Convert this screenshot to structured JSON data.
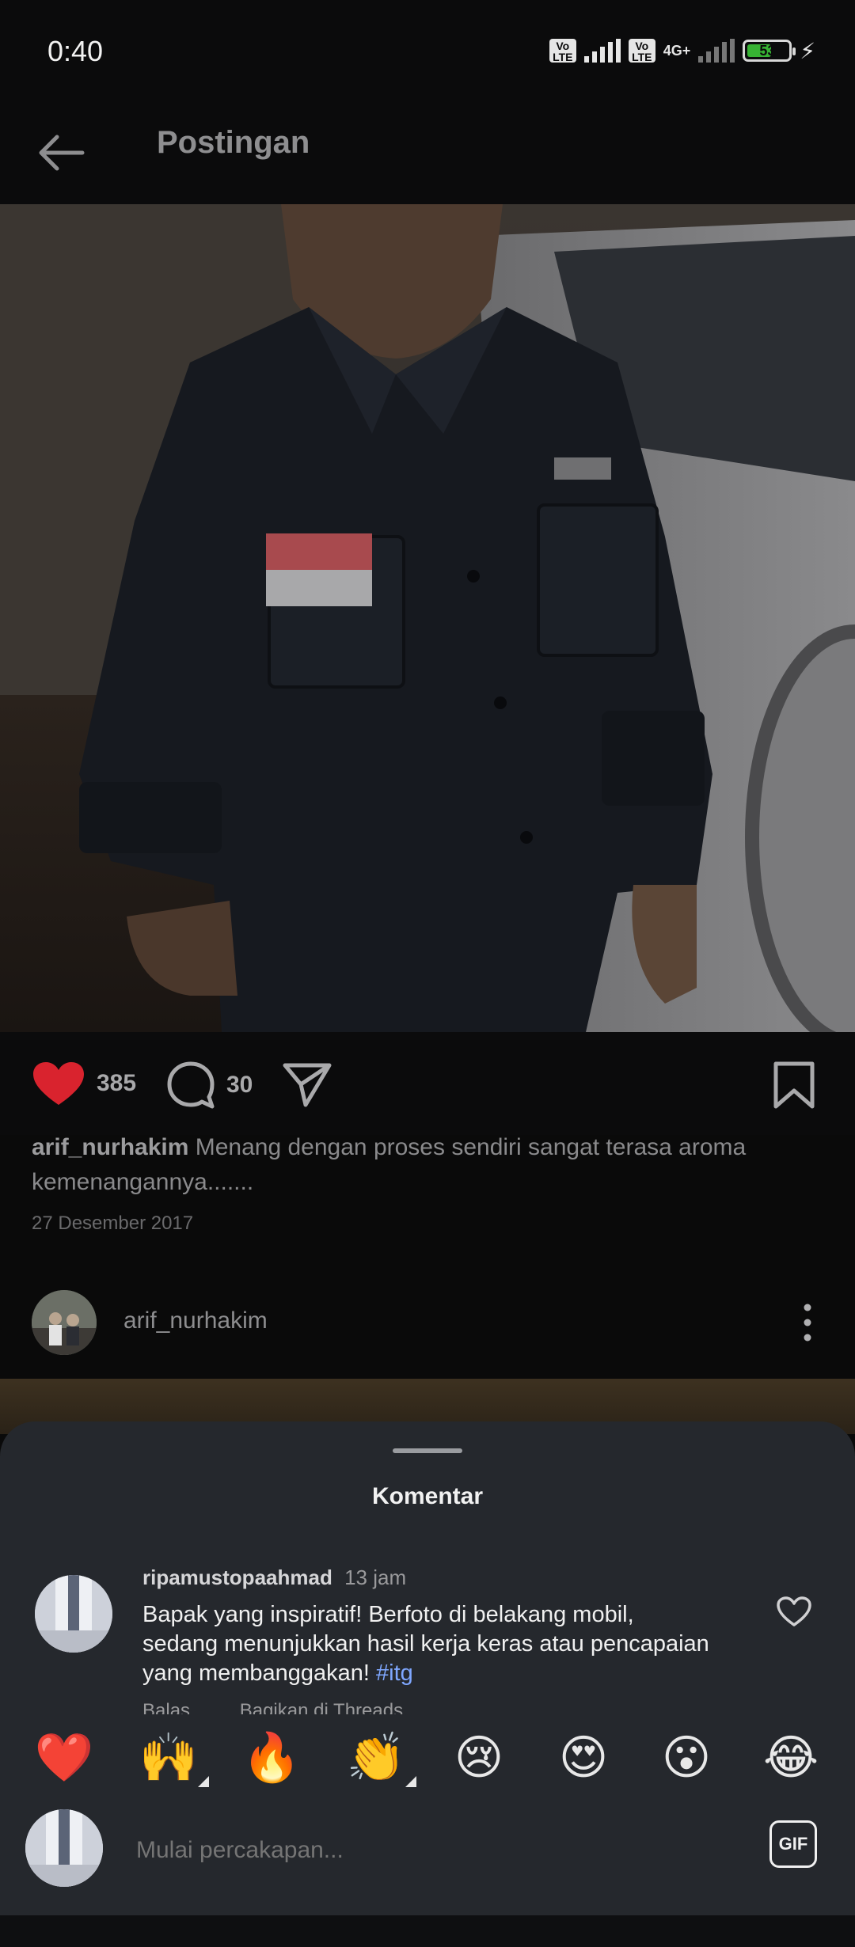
{
  "status_bar": {
    "time": "0:40",
    "volte1": "Vo LTE",
    "volte2": "Vo LTE",
    "network": "4G+",
    "battery": "53"
  },
  "header": {
    "title": "Postingan"
  },
  "post": {
    "likes": "385",
    "comments": "30",
    "caption_user": "arif_nurhakim",
    "caption_text": "Menang dengan proses sendiri sangat terasa aroma kemenangannya.......",
    "date": "27 Desember 2017",
    "next_author": "arif_nurhakim"
  },
  "comments_sheet": {
    "title": "Komentar",
    "comment": {
      "username": "ripamustopaahmad",
      "time": "13 jam",
      "text": "Bapak yang inspiratif!  Berfoto di belakang mobil, sedang menunjukkan hasil kerja keras atau pencapaian yang membanggakan!",
      "hashtag": "#itg",
      "reply_label": "Balas",
      "share_label": "Bagikan di Threads"
    },
    "emojis": [
      "❤️",
      "🙌",
      "🔥",
      "👏",
      "😢",
      "😍",
      "😮",
      "😂"
    ],
    "composer_placeholder": "Mulai percakapan...",
    "gif_label": "GIF"
  },
  "colors": {
    "heart_red": "#d9232e",
    "link_blue": "#7fa7ff",
    "sheet_bg": "#25282d"
  }
}
